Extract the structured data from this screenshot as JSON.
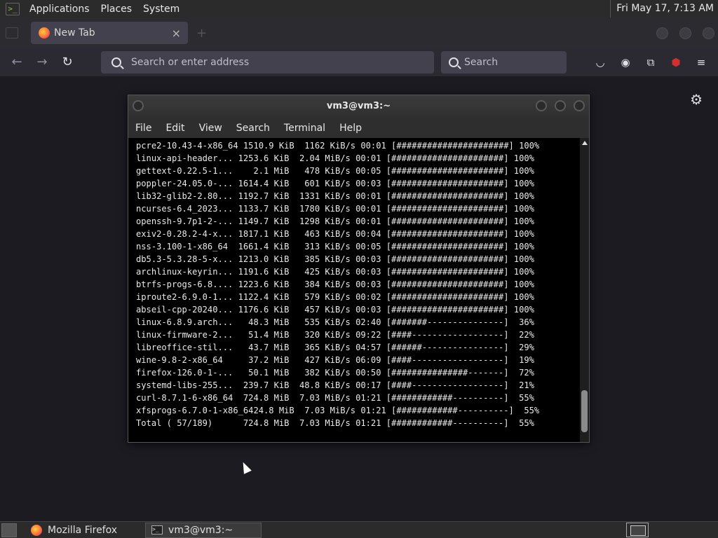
{
  "top_panel": {
    "menus": [
      "Applications",
      "Places",
      "System"
    ],
    "clock": "Fri May 17,  7:13 AM"
  },
  "browser": {
    "tab_title": "New Tab",
    "tab_close": "×",
    "new_tab": "+",
    "url_placeholder": "Search or enter address",
    "search_placeholder": "Search"
  },
  "terminal": {
    "title": "vm3@vm3:~",
    "menus": [
      "File",
      "Edit",
      "View",
      "Search",
      "Terminal",
      "Help"
    ],
    "lines": [
      "pcre2-10.43-4-x86_64 1510.9 KiB  1162 KiB/s 00:01 [######################] 100%",
      "linux-api-header... 1253.6 KiB  2.04 MiB/s 00:01 [######################] 100%",
      "gettext-0.22.5-1...    2.1 MiB   478 KiB/s 00:05 [######################] 100%",
      "poppler-24.05.0-... 1614.4 KiB   601 KiB/s 00:03 [######################] 100%",
      "lib32-glib2-2.80... 1192.7 KiB  1331 KiB/s 00:01 [######################] 100%",
      "ncurses-6.4_2023... 1133.7 KiB  1780 KiB/s 00:01 [######################] 100%",
      "openssh-9.7p1-2-... 1149.7 KiB  1298 KiB/s 00:01 [######################] 100%",
      "exiv2-0.28.2-4-x... 1817.1 KiB   463 KiB/s 00:04 [######################] 100%",
      "nss-3.100-1-x86_64  1661.4 KiB   313 KiB/s 00:05 [######################] 100%",
      "db5.3-5.3.28-5-x... 1213.0 KiB   385 KiB/s 00:03 [######################] 100%",
      "archlinux-keyrin... 1191.6 KiB   425 KiB/s 00:03 [######################] 100%",
      "btrfs-progs-6.8.... 1223.6 KiB   384 KiB/s 00:03 [######################] 100%",
      "iproute2-6.9.0-1... 1122.4 KiB   579 KiB/s 00:02 [######################] 100%",
      "abseil-cpp-20240... 1176.6 KiB   457 KiB/s 00:03 [######################] 100%",
      "linux-6.8.9.arch...   48.3 MiB   535 KiB/s 02:40 [#######---------------]  36%",
      "linux-firmware-2...   51.4 MiB   320 KiB/s 09:22 [####------------------]  22%",
      "libreoffice-stil...   43.7 MiB   365 KiB/s 04:57 [######----------------]  29%",
      "wine-9.8-2-x86_64     37.2 MiB   427 KiB/s 06:09 [####------------------]  19%",
      "firefox-126.0-1-...   50.1 MiB   382 KiB/s 00:50 [###############-------]  72%",
      "systemd-libs-255...  239.7 KiB  48.8 KiB/s 00:17 [####------------------]  21%",
      "curl-8.7.1-6-x86_64  724.8 MiB  7.03 MiB/s 01:21 [############----------]  55%",
      "xfsprogs-6.7.0-1-x86_6424.8 MiB  7.03 MiB/s 01:21 [############----------]  55%",
      "Total ( 57/189)      724.8 MiB  7.03 MiB/s 01:21 [############----------]  55%"
    ]
  },
  "taskbar": {
    "tasks": [
      "Mozilla Firefox",
      "vm3@vm3:~"
    ]
  }
}
